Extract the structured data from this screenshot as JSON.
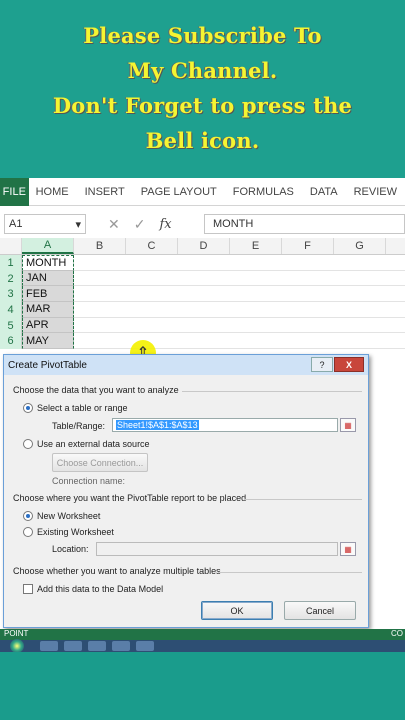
{
  "banner": {
    "lines": [
      "Please Subscribe To",
      "My Channel.",
      "Don't Forget to press the",
      "Bell icon."
    ]
  },
  "ribbon": {
    "file_tab": "FILE",
    "tabs": [
      "HOME",
      "INSERT",
      "PAGE LAYOUT",
      "FORMULAS",
      "DATA",
      "REVIEW"
    ]
  },
  "formula_bar": {
    "name_box": "A1",
    "formula": "MONTH"
  },
  "columns": [
    "A",
    "B",
    "C",
    "D",
    "E",
    "F",
    "G"
  ],
  "rows": [
    {
      "num": "1",
      "a": "MONTH"
    },
    {
      "num": "2",
      "a": "JAN"
    },
    {
      "num": "3",
      "a": "FEB"
    },
    {
      "num": "4",
      "a": "MAR"
    },
    {
      "num": "5",
      "a": "APR"
    },
    {
      "num": "6",
      "a": "MAY"
    }
  ],
  "dialog": {
    "title": "Create PivotTable",
    "help": "?",
    "close": "X",
    "section1": "Choose the data that you want to analyze",
    "opt_select_table": "Select a table or range",
    "table_range_label": "Table/Range:",
    "table_range_value": "Sheet1!$A$1:$A$13",
    "opt_external": "Use an external data source",
    "choose_connection": "Choose Connection...",
    "connection_name": "Connection name:",
    "section2": "Choose where you want the PivotTable report to be placed",
    "opt_new_ws": "New Worksheet",
    "opt_existing_ws": "Existing Worksheet",
    "location_label": "Location:",
    "section3": "Choose whether you want to analyze multiple tables",
    "add_data_model": "Add this data to the Data Model",
    "ok": "OK",
    "cancel": "Cancel"
  },
  "status": {
    "left": "POINT",
    "right": "CO"
  },
  "colors": {
    "excel_green": "#217346",
    "banner_bg": "#1ea08f",
    "banner_text": "#f5f532"
  }
}
